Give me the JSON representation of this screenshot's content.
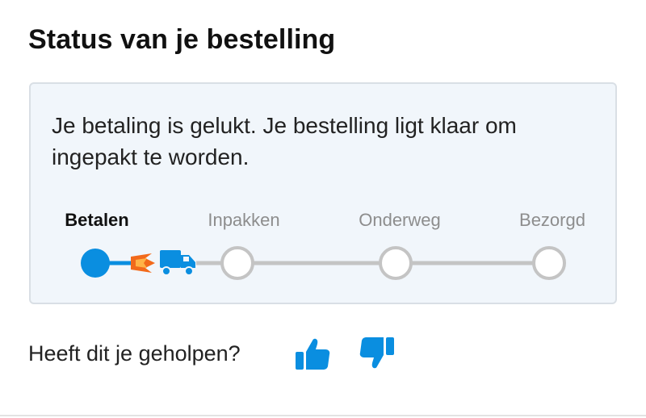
{
  "header": {
    "title": "Status van je bestelling"
  },
  "status": {
    "message": "Je betaling is gelukt. Je bestelling ligt klaar om ingepakt te worden.",
    "steps": [
      {
        "label": "Betalen",
        "state": "done"
      },
      {
        "label": "Inpakken",
        "state": "pending"
      },
      {
        "label": "Onderweg",
        "state": "pending"
      },
      {
        "label": "Bezorgd",
        "state": "pending"
      }
    ],
    "progress_icon": "delivery-truck-icon"
  },
  "feedback": {
    "question": "Heeft dit je geholpen?",
    "yes_icon": "thumbs-up-icon",
    "no_icon": "thumbs-down-icon"
  },
  "colors": {
    "accent": "#0a8ee0",
    "flame_orange": "#f26a1b",
    "inactive_track": "#c4c4c4",
    "card_background": "#f1f6fb"
  }
}
